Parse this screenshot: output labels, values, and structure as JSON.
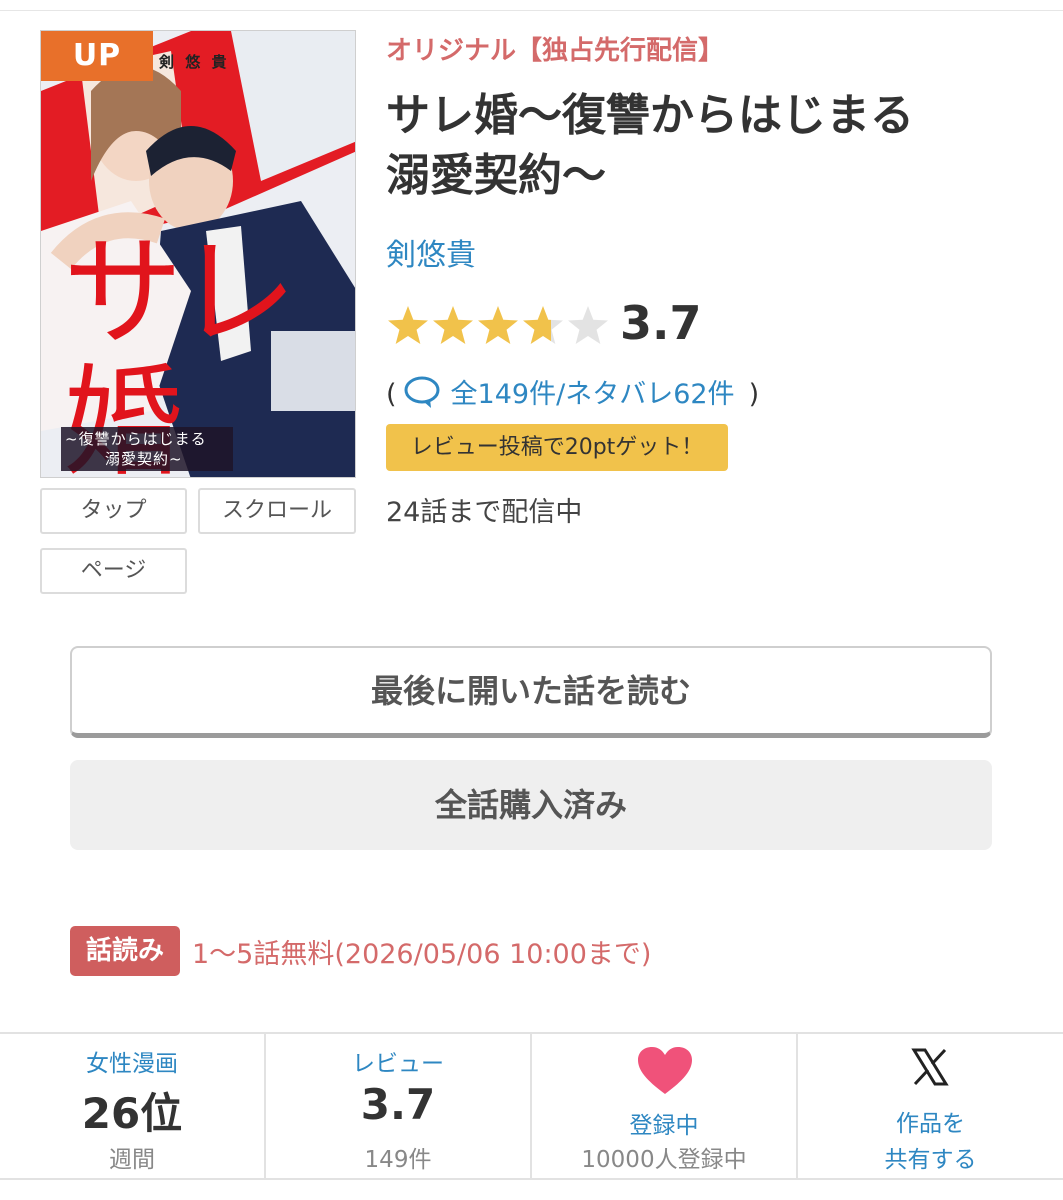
{
  "cover": {
    "badge": "UP",
    "author_print": "剣 悠 貴",
    "title_print": "サレ婚",
    "subtitle_line1": "~復讐からはじまる",
    "subtitle_line2": "溺愛契約~"
  },
  "view_modes": [
    "タップ",
    "スクロール",
    "ページ"
  ],
  "info": {
    "label": "オリジナル【独占先行配信】",
    "title_line1": "サレ婚〜復讐からはじまる",
    "title_line2": "溺愛契約〜",
    "author": "剣悠貴",
    "rating": "3.7",
    "rating_value": 3.7,
    "rating_max": 5,
    "review_open": "(",
    "review_all": "全149件",
    "review_sep": "/",
    "review_spoiler": "ネタバレ62件",
    "review_close": ")",
    "review_badge": "レビュー投稿で20ptゲット！",
    "episodes": "24話まで配信中"
  },
  "actions": {
    "read_last": "最後に開いた話を読む",
    "purchased": "全話購入済み"
  },
  "free": {
    "badge": "話読み",
    "text": "1〜5話無料(2026/05/06 10:00まで)"
  },
  "stats": {
    "ranking": {
      "label": "女性漫画",
      "value": "26位",
      "sub": "週間"
    },
    "review": {
      "label": "レビュー",
      "value": "3.7",
      "sub": "149件"
    },
    "favorite": {
      "label": "登録中",
      "sub": "10000人登録中"
    },
    "share": {
      "line1": "作品を",
      "line2": "共有する"
    }
  },
  "colors": {
    "accent_blue": "#2e87c2",
    "accent_red": "#d46a6a",
    "badge_orange": "#e8702a",
    "star_gold": "#f1c24b",
    "heart_pink": "#f0527a"
  }
}
